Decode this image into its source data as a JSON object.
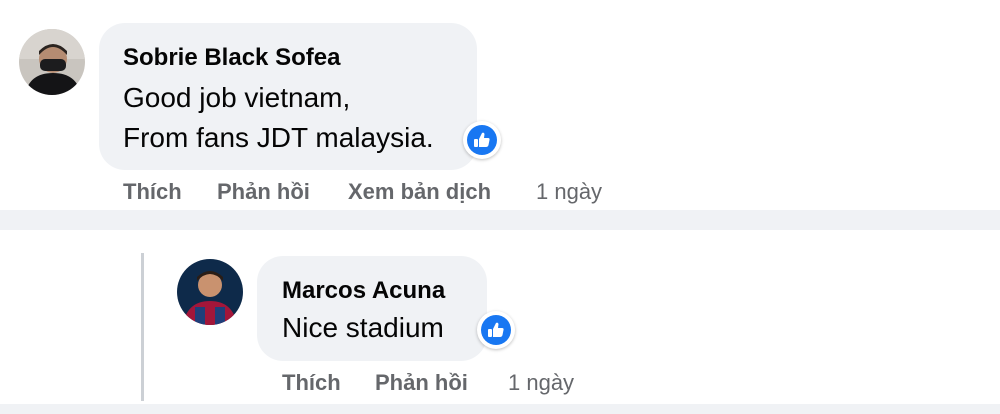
{
  "comment": {
    "author": "Sobrie Black Sofea",
    "line1": "Good job vietnam,",
    "line2": "From fans JDT malaysia.",
    "actions": {
      "like": "Thích",
      "reply": "Phản hồi",
      "translate": "Xem bản dịch"
    },
    "time": "1 ngày",
    "reaction_icon": "like-icon"
  },
  "reply": {
    "author": "Marcos Acuna",
    "text": "Nice stadium",
    "actions": {
      "like": "Thích",
      "reply": "Phản hồi"
    },
    "time": "1 ngày",
    "reaction_icon": "like-icon"
  },
  "colors": {
    "bubble": "#f0f2f5",
    "like_blue": "#1877f2",
    "meta_gray": "#65676b",
    "text": "#050505"
  }
}
